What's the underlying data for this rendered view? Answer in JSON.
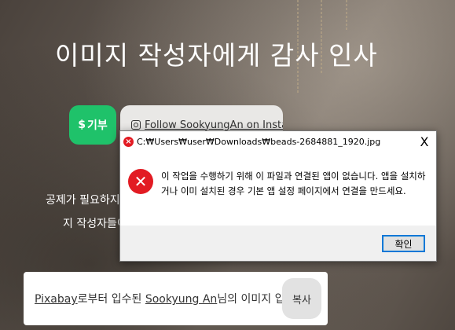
{
  "page": {
    "title": "이미지 작성자에게 감사 인사",
    "donate_symbol": "$",
    "donate_label": "기부",
    "follow_label": "Follow SookyungAn on Instagram",
    "side_line_1": "공제가 필요하지",
    "side_line_2": "지 작성자들이",
    "credit": {
      "source_link": "Pixabay",
      "text_mid": "로부터 입수된 ",
      "author_link": "Sookyung An",
      "text_end": "님의 이미지 입니다."
    },
    "copy_label": "복사"
  },
  "dialog": {
    "title": "C:₩Users₩user₩Downloads₩beads-2684881_1920.jpg",
    "close_glyph": "X",
    "message": "이 작업을 수행하기 위해 이 파일과 연결된 앱이 없습니다. 앱을 설치하거나 이미 설치된 경우 기본 앱 설정 페이지에서 연결을 만드세요.",
    "ok_label": "확인",
    "error_icon": "error-x-icon"
  },
  "colors": {
    "donate_green": "#1fc26a",
    "error_red": "#e21b23",
    "focus_blue": "#0078d7"
  }
}
